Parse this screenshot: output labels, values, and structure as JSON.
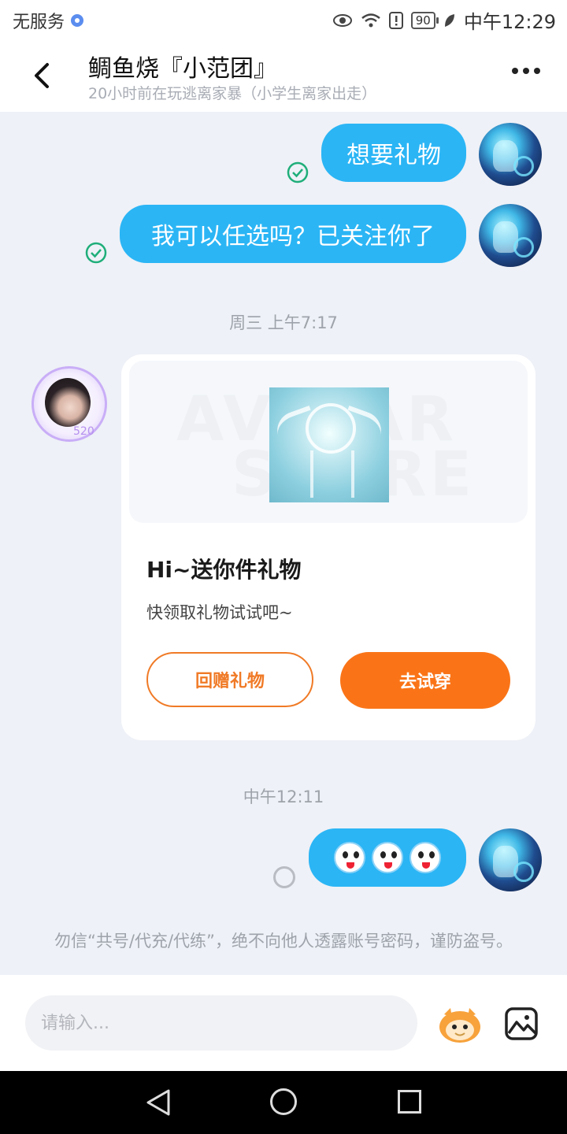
{
  "status_bar": {
    "carrier": "无服务",
    "battery": "90",
    "time": "中午12:29",
    "icons": [
      "eye-icon",
      "wifi-icon",
      "alert-icon",
      "battery-icon",
      "leaf-icon"
    ]
  },
  "header": {
    "title": "鲷鱼烧『小范团』",
    "subtitle": "20小时前在玩逃离家暴（小学生离家出走）",
    "back_icon": "back-arrow-icon",
    "more_icon": "more-dots-icon"
  },
  "messages": [
    {
      "sender": "me",
      "text": "想要礼物",
      "status": "sent"
    },
    {
      "sender": "me",
      "text": "我可以任选吗？已关注你了",
      "status": "sent"
    }
  ],
  "timestamps": [
    "周三 上午7:17",
    "中午12:11"
  ],
  "other_avatar_tag": "520",
  "gift_card": {
    "watermark_line1": "AVATAR",
    "watermark_line2": "STORE",
    "title": "Hi~送你件礼物",
    "desc": "快领取礼物试试吧~",
    "button_gift_back": "回赠礼物",
    "button_try_on": "去试穿",
    "accent_color": "#fa7417"
  },
  "emoji_message": {
    "sender": "me",
    "emoji": "crying-face-sticker",
    "count": 3,
    "status": "pending"
  },
  "warning_text": "勿信“共号/代充/代练”，绝不向他人透露账号密码，谨防盗号。",
  "input": {
    "placeholder": "请输入..."
  },
  "colors": {
    "bubble": "#2bb5f5",
    "check": "#1fae7a",
    "background": "#eef1f7"
  },
  "nav_bar": {
    "icons": [
      "nav-back-icon",
      "nav-home-icon",
      "nav-recent-icon"
    ]
  }
}
